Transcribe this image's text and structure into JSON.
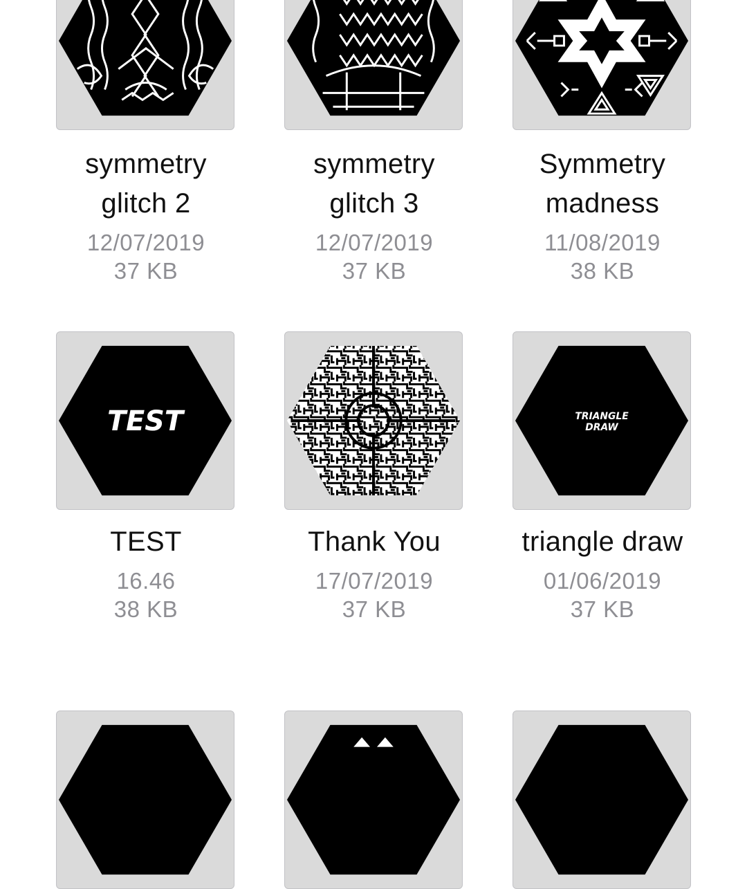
{
  "documents": [
    {
      "name_line1": "symmetry",
      "name_line2": "glitch 2",
      "date": "12/07/2019",
      "size": "37 KB",
      "thumbnail": "symmetry-glitch-pattern"
    },
    {
      "name_line1": "symmetry",
      "name_line2": "glitch 3",
      "date": "12/07/2019",
      "size": "37 KB",
      "thumbnail": "symmetry-glitch-pattern"
    },
    {
      "name_line1": "Symmetry",
      "name_line2": "madness",
      "date": "11/08/2019",
      "size": "38 KB",
      "thumbnail": "star-triangle-pattern"
    },
    {
      "name_line1": "TEST",
      "name_line2": "",
      "date": "16.46",
      "size": "38 KB",
      "thumbnail": "hexagon-with-text",
      "thumb_text": "TEST"
    },
    {
      "name_line1": "Thank You",
      "name_line2": "",
      "date": "17/07/2019",
      "size": "37 KB",
      "thumbnail": "maze-pattern"
    },
    {
      "name_line1": "triangle draw",
      "name_line2": "",
      "date": "01/06/2019",
      "size": "37 KB",
      "thumbnail": "hexagon-with-text",
      "thumb_text_line1": "TRIANGLE",
      "thumb_text_line2": "DRAW"
    }
  ],
  "colors": {
    "background": "#ffffff",
    "thumbnail_bg": "#dadada",
    "title_text": "#111111",
    "meta_text": "#8e8e93",
    "hexagon_fill": "#000000"
  }
}
